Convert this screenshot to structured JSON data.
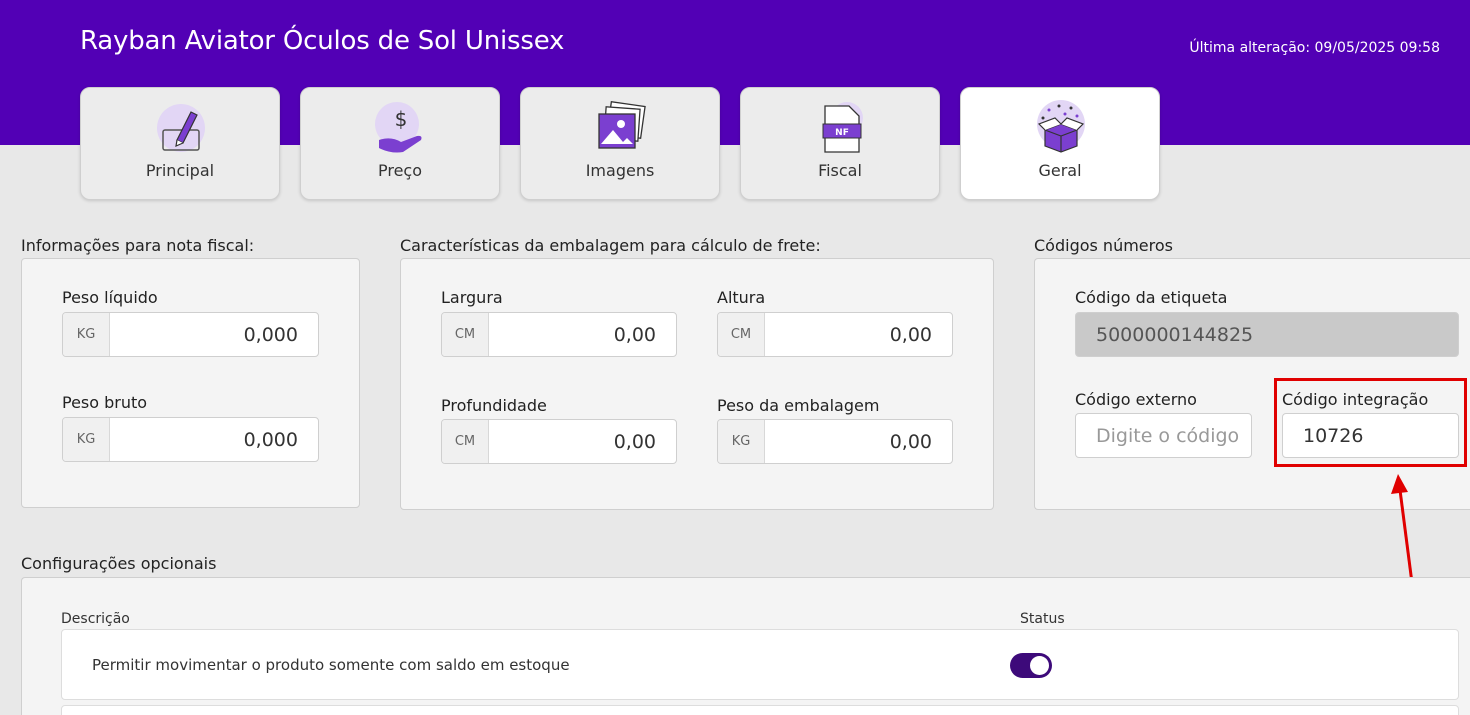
{
  "header": {
    "title": "Rayban Aviator Óculos de Sol Unissex",
    "last_update": "Última alteração: 09/05/2025 09:58",
    "bg_color": "#5200b5"
  },
  "tabs": [
    {
      "label": "Principal",
      "icon": "pencil-edit-icon",
      "active": false
    },
    {
      "label": "Preço",
      "icon": "dollar-hand-icon",
      "active": false
    },
    {
      "label": "Imagens",
      "icon": "images-icon",
      "active": false
    },
    {
      "label": "Fiscal",
      "icon": "nf-document-icon",
      "active": false
    },
    {
      "label": "Geral",
      "icon": "gift-box-icon",
      "active": true
    }
  ],
  "nota_fiscal": {
    "title": "Informações para nota fiscal:",
    "peso_liquido": {
      "label": "Peso líquido",
      "unit": "KG",
      "value": "0,000"
    },
    "peso_bruto": {
      "label": "Peso bruto",
      "unit": "KG",
      "value": "0,000"
    }
  },
  "embalagem": {
    "title": "Características da embalagem para cálculo de frete:",
    "largura": {
      "label": "Largura",
      "unit": "CM",
      "value": "0,00"
    },
    "altura": {
      "label": "Altura",
      "unit": "CM",
      "value": "0,00"
    },
    "profundidade": {
      "label": "Profundidade",
      "unit": "CM",
      "value": "0,00"
    },
    "peso_embalagem": {
      "label": "Peso da embalagem",
      "unit": "KG",
      "value": "0,00"
    }
  },
  "codigos": {
    "title": "Códigos números",
    "etiqueta": {
      "label": "Código da etiqueta",
      "value": "5000000144825"
    },
    "externo": {
      "label": "Código externo",
      "placeholder": "Digite o código"
    },
    "integracao": {
      "label": "Código integração",
      "value": "10726"
    }
  },
  "opcionais": {
    "title": "Configurações opcionais",
    "col_descricao": "Descrição",
    "col_status": "Status",
    "rows": [
      {
        "text": "Permitir movimentar o produto somente com saldo em estoque",
        "status": true
      }
    ]
  },
  "annotation_color": "#e00000"
}
